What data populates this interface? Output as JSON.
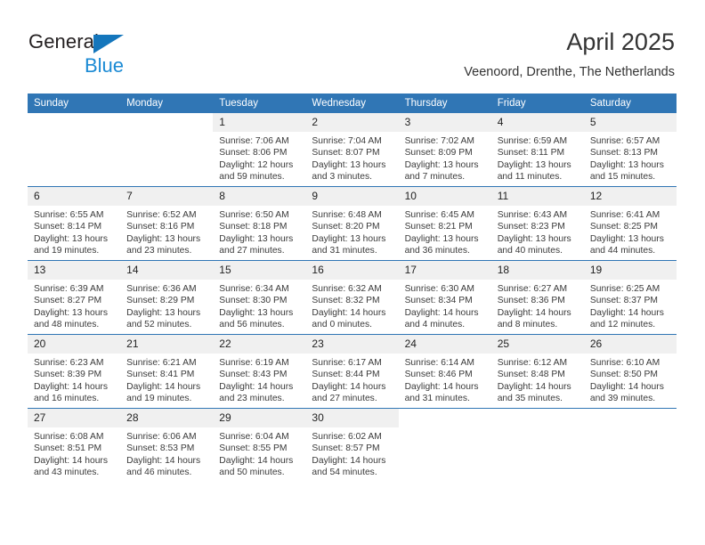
{
  "brand": {
    "name_top": "General",
    "name_bottom": "Blue",
    "accent_color": "#1476bc",
    "blue_text_color": "#1b8ad4"
  },
  "header": {
    "title": "April 2025",
    "subtitle": "Veenoord, Drenthe, The Netherlands"
  },
  "calendar": {
    "header_color": "#3076b5",
    "daynum_band_color": "#f0f0f0",
    "weekday_headers": [
      "Sunday",
      "Monday",
      "Tuesday",
      "Wednesday",
      "Thursday",
      "Friday",
      "Saturday"
    ],
    "weeks": [
      [
        {
          "day": "",
          "sunrise": "",
          "sunset": "",
          "daylight": "",
          "blank": true
        },
        {
          "day": "",
          "sunrise": "",
          "sunset": "",
          "daylight": "",
          "blank": true
        },
        {
          "day": "1",
          "sunrise": "Sunrise: 7:06 AM",
          "sunset": "Sunset: 8:06 PM",
          "daylight": "Daylight: 12 hours and 59 minutes."
        },
        {
          "day": "2",
          "sunrise": "Sunrise: 7:04 AM",
          "sunset": "Sunset: 8:07 PM",
          "daylight": "Daylight: 13 hours and 3 minutes."
        },
        {
          "day": "3",
          "sunrise": "Sunrise: 7:02 AM",
          "sunset": "Sunset: 8:09 PM",
          "daylight": "Daylight: 13 hours and 7 minutes."
        },
        {
          "day": "4",
          "sunrise": "Sunrise: 6:59 AM",
          "sunset": "Sunset: 8:11 PM",
          "daylight": "Daylight: 13 hours and 11 minutes."
        },
        {
          "day": "5",
          "sunrise": "Sunrise: 6:57 AM",
          "sunset": "Sunset: 8:13 PM",
          "daylight": "Daylight: 13 hours and 15 minutes."
        }
      ],
      [
        {
          "day": "6",
          "sunrise": "Sunrise: 6:55 AM",
          "sunset": "Sunset: 8:14 PM",
          "daylight": "Daylight: 13 hours and 19 minutes."
        },
        {
          "day": "7",
          "sunrise": "Sunrise: 6:52 AM",
          "sunset": "Sunset: 8:16 PM",
          "daylight": "Daylight: 13 hours and 23 minutes."
        },
        {
          "day": "8",
          "sunrise": "Sunrise: 6:50 AM",
          "sunset": "Sunset: 8:18 PM",
          "daylight": "Daylight: 13 hours and 27 minutes."
        },
        {
          "day": "9",
          "sunrise": "Sunrise: 6:48 AM",
          "sunset": "Sunset: 8:20 PM",
          "daylight": "Daylight: 13 hours and 31 minutes."
        },
        {
          "day": "10",
          "sunrise": "Sunrise: 6:45 AM",
          "sunset": "Sunset: 8:21 PM",
          "daylight": "Daylight: 13 hours and 36 minutes."
        },
        {
          "day": "11",
          "sunrise": "Sunrise: 6:43 AM",
          "sunset": "Sunset: 8:23 PM",
          "daylight": "Daylight: 13 hours and 40 minutes."
        },
        {
          "day": "12",
          "sunrise": "Sunrise: 6:41 AM",
          "sunset": "Sunset: 8:25 PM",
          "daylight": "Daylight: 13 hours and 44 minutes."
        }
      ],
      [
        {
          "day": "13",
          "sunrise": "Sunrise: 6:39 AM",
          "sunset": "Sunset: 8:27 PM",
          "daylight": "Daylight: 13 hours and 48 minutes."
        },
        {
          "day": "14",
          "sunrise": "Sunrise: 6:36 AM",
          "sunset": "Sunset: 8:29 PM",
          "daylight": "Daylight: 13 hours and 52 minutes."
        },
        {
          "day": "15",
          "sunrise": "Sunrise: 6:34 AM",
          "sunset": "Sunset: 8:30 PM",
          "daylight": "Daylight: 13 hours and 56 minutes."
        },
        {
          "day": "16",
          "sunrise": "Sunrise: 6:32 AM",
          "sunset": "Sunset: 8:32 PM",
          "daylight": "Daylight: 14 hours and 0 minutes."
        },
        {
          "day": "17",
          "sunrise": "Sunrise: 6:30 AM",
          "sunset": "Sunset: 8:34 PM",
          "daylight": "Daylight: 14 hours and 4 minutes."
        },
        {
          "day": "18",
          "sunrise": "Sunrise: 6:27 AM",
          "sunset": "Sunset: 8:36 PM",
          "daylight": "Daylight: 14 hours and 8 minutes."
        },
        {
          "day": "19",
          "sunrise": "Sunrise: 6:25 AM",
          "sunset": "Sunset: 8:37 PM",
          "daylight": "Daylight: 14 hours and 12 minutes."
        }
      ],
      [
        {
          "day": "20",
          "sunrise": "Sunrise: 6:23 AM",
          "sunset": "Sunset: 8:39 PM",
          "daylight": "Daylight: 14 hours and 16 minutes."
        },
        {
          "day": "21",
          "sunrise": "Sunrise: 6:21 AM",
          "sunset": "Sunset: 8:41 PM",
          "daylight": "Daylight: 14 hours and 19 minutes."
        },
        {
          "day": "22",
          "sunrise": "Sunrise: 6:19 AM",
          "sunset": "Sunset: 8:43 PM",
          "daylight": "Daylight: 14 hours and 23 minutes."
        },
        {
          "day": "23",
          "sunrise": "Sunrise: 6:17 AM",
          "sunset": "Sunset: 8:44 PM",
          "daylight": "Daylight: 14 hours and 27 minutes."
        },
        {
          "day": "24",
          "sunrise": "Sunrise: 6:14 AM",
          "sunset": "Sunset: 8:46 PM",
          "daylight": "Daylight: 14 hours and 31 minutes."
        },
        {
          "day": "25",
          "sunrise": "Sunrise: 6:12 AM",
          "sunset": "Sunset: 8:48 PM",
          "daylight": "Daylight: 14 hours and 35 minutes."
        },
        {
          "day": "26",
          "sunrise": "Sunrise: 6:10 AM",
          "sunset": "Sunset: 8:50 PM",
          "daylight": "Daylight: 14 hours and 39 minutes."
        }
      ],
      [
        {
          "day": "27",
          "sunrise": "Sunrise: 6:08 AM",
          "sunset": "Sunset: 8:51 PM",
          "daylight": "Daylight: 14 hours and 43 minutes."
        },
        {
          "day": "28",
          "sunrise": "Sunrise: 6:06 AM",
          "sunset": "Sunset: 8:53 PM",
          "daylight": "Daylight: 14 hours and 46 minutes."
        },
        {
          "day": "29",
          "sunrise": "Sunrise: 6:04 AM",
          "sunset": "Sunset: 8:55 PM",
          "daylight": "Daylight: 14 hours and 50 minutes."
        },
        {
          "day": "30",
          "sunrise": "Sunrise: 6:02 AM",
          "sunset": "Sunset: 8:57 PM",
          "daylight": "Daylight: 14 hours and 54 minutes."
        },
        {
          "day": "",
          "sunrise": "",
          "sunset": "",
          "daylight": "",
          "blank": true
        },
        {
          "day": "",
          "sunrise": "",
          "sunset": "",
          "daylight": "",
          "blank": true
        },
        {
          "day": "",
          "sunrise": "",
          "sunset": "",
          "daylight": "",
          "blank": true
        }
      ]
    ]
  }
}
